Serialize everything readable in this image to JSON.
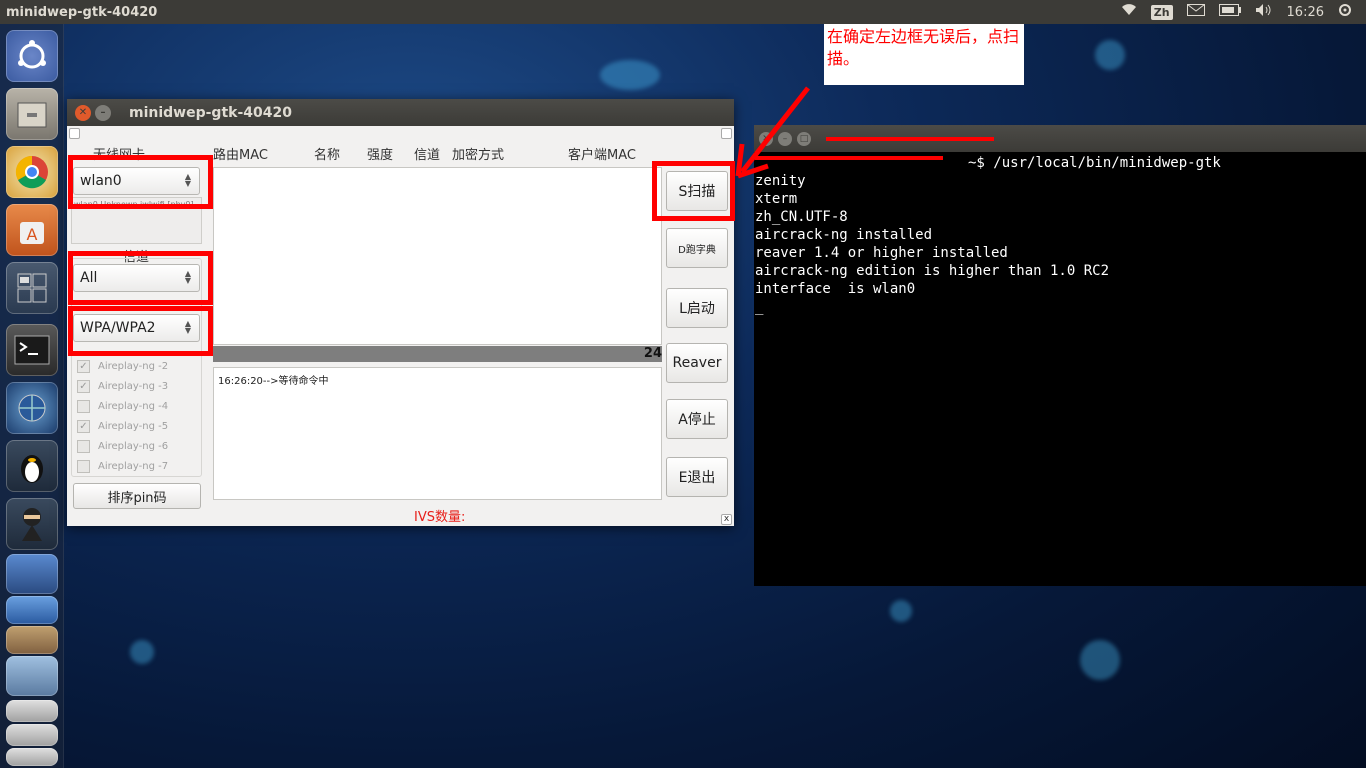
{
  "top_panel": {
    "app_title": "minidwep-gtk-40420",
    "input_method": "Zh",
    "clock": "16:26"
  },
  "launcher": {
    "items": [
      "dash-home",
      "files",
      "chrome",
      "software-center",
      "workspace-switcher",
      "terminal",
      "network-tool",
      "qq",
      "ninja",
      "stack-1",
      "stack-2",
      "stack-3",
      "stack-4",
      "stack-5",
      "stack-6"
    ]
  },
  "window": {
    "title": "minidwep-gtk-40420",
    "labels": {
      "nic": "无线网卡",
      "channel": "信道",
      "encryption": "加密方式"
    },
    "columns": [
      "路由MAC",
      "名称",
      "强度",
      "信道",
      "加密方式",
      "客户端MAC"
    ],
    "nic_value": "wlan0",
    "nic_info": "wlan0 Unknown iwlwifi [phy0]",
    "channel_value": "All",
    "encryption_value": "WPA/WPA2",
    "aireplay": [
      {
        "label": "Aireplay-ng -2",
        "checked": true
      },
      {
        "label": "Aireplay-ng -3",
        "checked": true
      },
      {
        "label": "Aireplay-ng -4",
        "checked": false
      },
      {
        "label": "Aireplay-ng -5",
        "checked": true
      },
      {
        "label": "Aireplay-ng -6",
        "checked": false
      },
      {
        "label": "Aireplay-ng -7",
        "checked": false
      }
    ],
    "pin_button": "排序pin码",
    "progress_value": "24",
    "log_text": "16:26:20-->等待命令中",
    "ivs_label": "IVS数量:",
    "buttons": {
      "scan": "S扫描",
      "dict": "D跑字典",
      "start": "L启动",
      "reaver": "Reaver",
      "stop": "A停止",
      "exit": "E退出"
    }
  },
  "terminal": {
    "title": "~",
    "lines": [
      "~$ /usr/local/bin/minidwep-gtk",
      "zenity",
      "xterm",
      "zh_CN.UTF-8",
      "aircrack-ng installed",
      "reaver 1.4 or higher installed",
      "aircrack-ng edition is higher than 1.0 RC2",
      "interface  is wlan0",
      "",
      "_"
    ]
  },
  "annotation": {
    "text": "在确定左边框无误后，点扫描。",
    "color": "#ff0000"
  }
}
